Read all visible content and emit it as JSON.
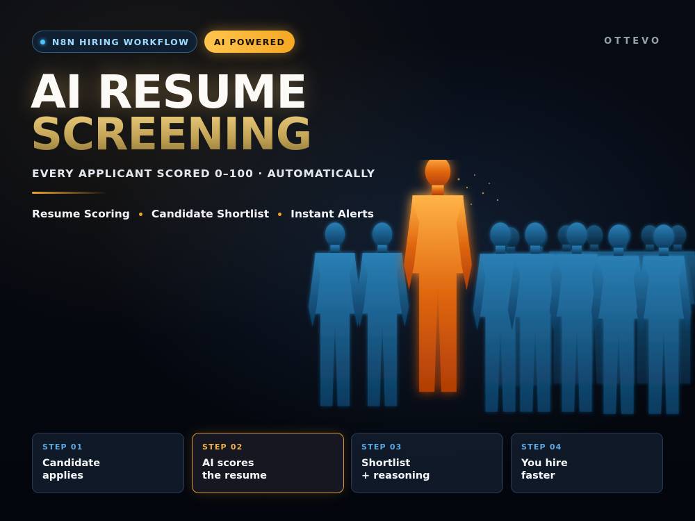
{
  "header": {
    "workflow_badge": "N8N HIRING WORKFLOW",
    "ai_badge": "AI POWERED",
    "brand": "OTTEVO"
  },
  "hero": {
    "title_line1": "AI RESUME",
    "title_line2": "SCREENING",
    "subtitle": "EVERY APPLICANT SCORED 0–100 · AUTOMATICALLY",
    "features": [
      "Resume Scoring",
      "Candidate Shortlist",
      "Instant Alerts"
    ]
  },
  "steps": [
    {
      "number": "STEP 01",
      "text": "Candidate\napplies"
    },
    {
      "number": "STEP 02",
      "text": "AI scores\nthe resume"
    },
    {
      "number": "STEP 03",
      "text": "Shortlist\n+ reasoning"
    },
    {
      "number": "STEP 04",
      "text": "You hire\nfaster"
    }
  ],
  "colors": {
    "accent_gold": "#f0a22a",
    "accent_blue": "#4fc3ff",
    "background": "#05080f"
  }
}
